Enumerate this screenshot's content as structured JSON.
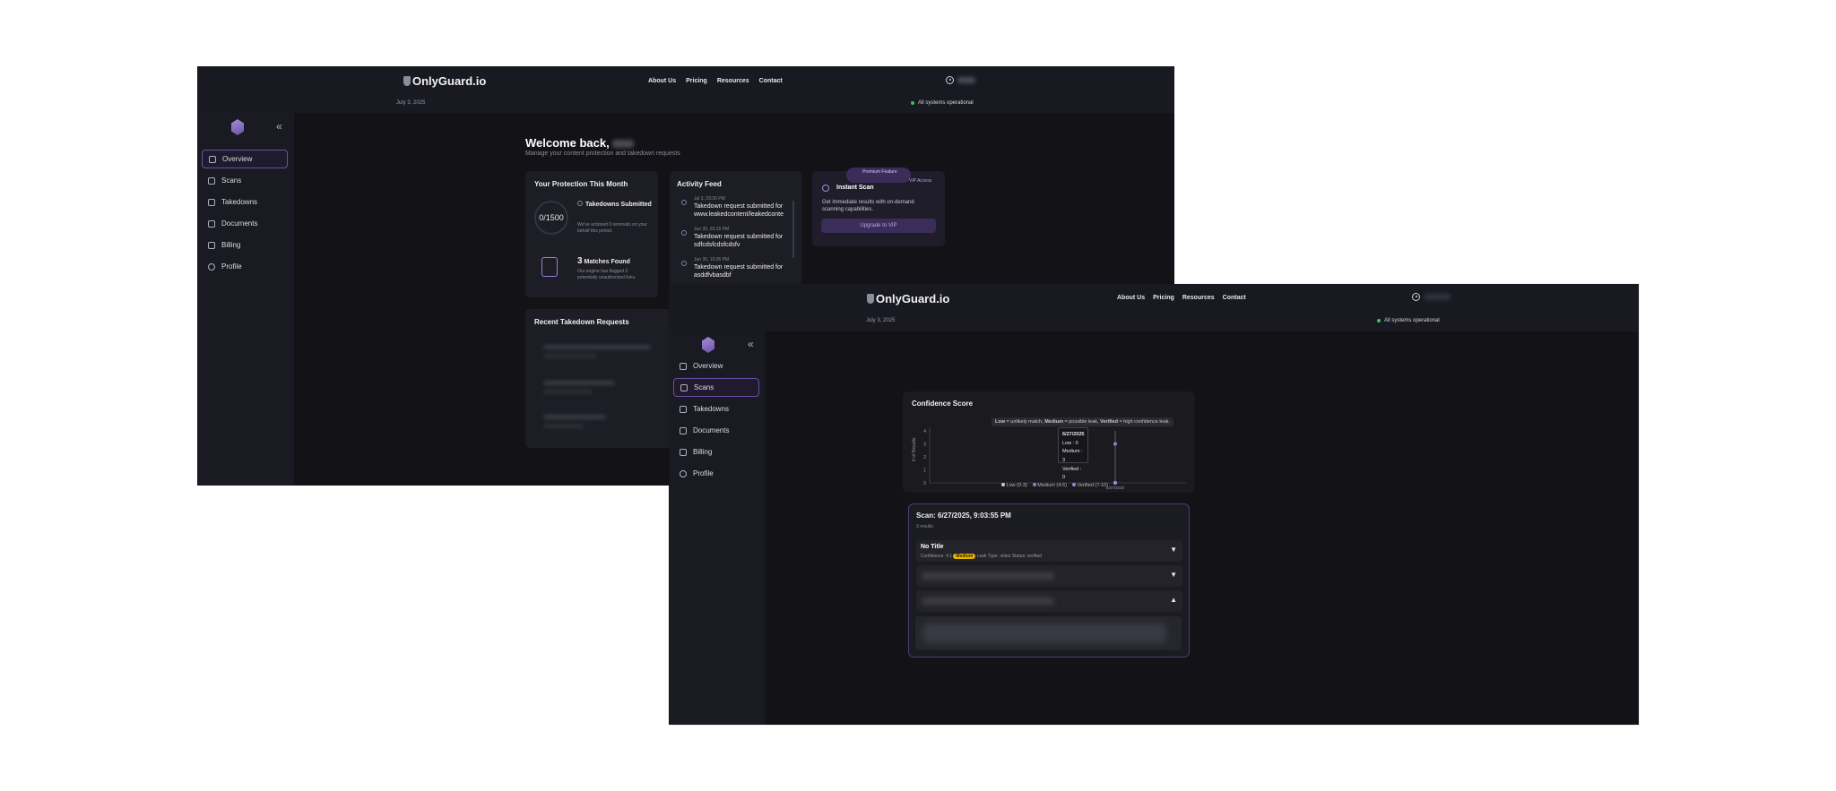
{
  "brand": "OnlyGuard.io",
  "nav": [
    "About Us",
    "Pricing",
    "Resources",
    "Contact"
  ],
  "date": "July 3, 2025",
  "system_status": "All systems operational",
  "sidebar_items": [
    "Overview",
    "Scans",
    "Takedowns",
    "Documents",
    "Billing",
    "Profile"
  ],
  "dashboard": {
    "welcome": "Welcome back,",
    "subtitle": "Manage your content protection and takedown requests",
    "protection": {
      "title": "Your Protection This Month",
      "ring_value": "0/1500",
      "takedowns_label": "Takedowns Submitted",
      "takedowns_desc": "We've actioned 0 removals on your behalf this period.",
      "matches_count": "3",
      "matches_label": "Matches Found",
      "matches_desc": "Our engine has flagged 3 potentially unauthorized links."
    },
    "activity": {
      "title": "Activity Feed",
      "items": [
        {
          "time": "Jul 3, 03:30 PM",
          "text": "Takedown request submitted for www.leakedcontent/leakedconte"
        },
        {
          "time": "Jun 30, 03:15 PM",
          "text": "Takedown request submitted for sdfcdsfcdsfcdsfv"
        },
        {
          "time": "Jun 30, 10:35 PM",
          "text": "Takedown request submitted for asddfvbasdbf"
        }
      ]
    },
    "instant_scan": {
      "badge": "Premium Feature",
      "vip": "VIP Access",
      "title": "Instant Scan",
      "desc": "Get immediate results with on-demand scanning capabilities.",
      "button": "Upgrade to VIP"
    },
    "recent_title": "Recent Takedown Requests"
  },
  "scans": {
    "chart_title": "Confidence Score",
    "chart_note": {
      "low": "Low",
      "low_desc": "= unlikely match,",
      "medium": "Medium",
      "medium_desc": "= possible leak,",
      "verified": "Verified",
      "verified_desc": "= high confidence leak."
    },
    "tooltip": {
      "date": "6/27/2025",
      "low": "Low : 0",
      "medium": "Medium : 3",
      "verified": "Verified : 0"
    },
    "legend": [
      "Low (0-3)",
      "Medium (4-6)",
      "Verified (7-10)"
    ],
    "scan_title": "Scan: 6/27/2025, 9:03:55 PM",
    "scan_results": "3 results",
    "row1": {
      "title": "No Title",
      "confidence": "Confidence: 4.1",
      "badge": "Medium",
      "leak_type": "Leak Type: video",
      "status": "Status: verified"
    },
    "chevron_down": "▼",
    "chevron_up": "▲"
  },
  "chart_data": {
    "type": "line",
    "x": [
      "6/27/2025"
    ],
    "series": [
      {
        "name": "Low",
        "values": [
          0
        ]
      },
      {
        "name": "Medium",
        "values": [
          3
        ]
      },
      {
        "name": "Verified",
        "values": [
          0
        ]
      }
    ],
    "ylabel": "# of Results",
    "yticks": [
      "0",
      "1",
      "2",
      "3",
      "4"
    ],
    "ylim": [
      0,
      4
    ],
    "grid": false,
    "legend_position": "bottom"
  },
  "colors": {
    "accent": "#6b4fa6",
    "status_ok": "#3ec06a",
    "badge_medium": "#e6b800"
  }
}
